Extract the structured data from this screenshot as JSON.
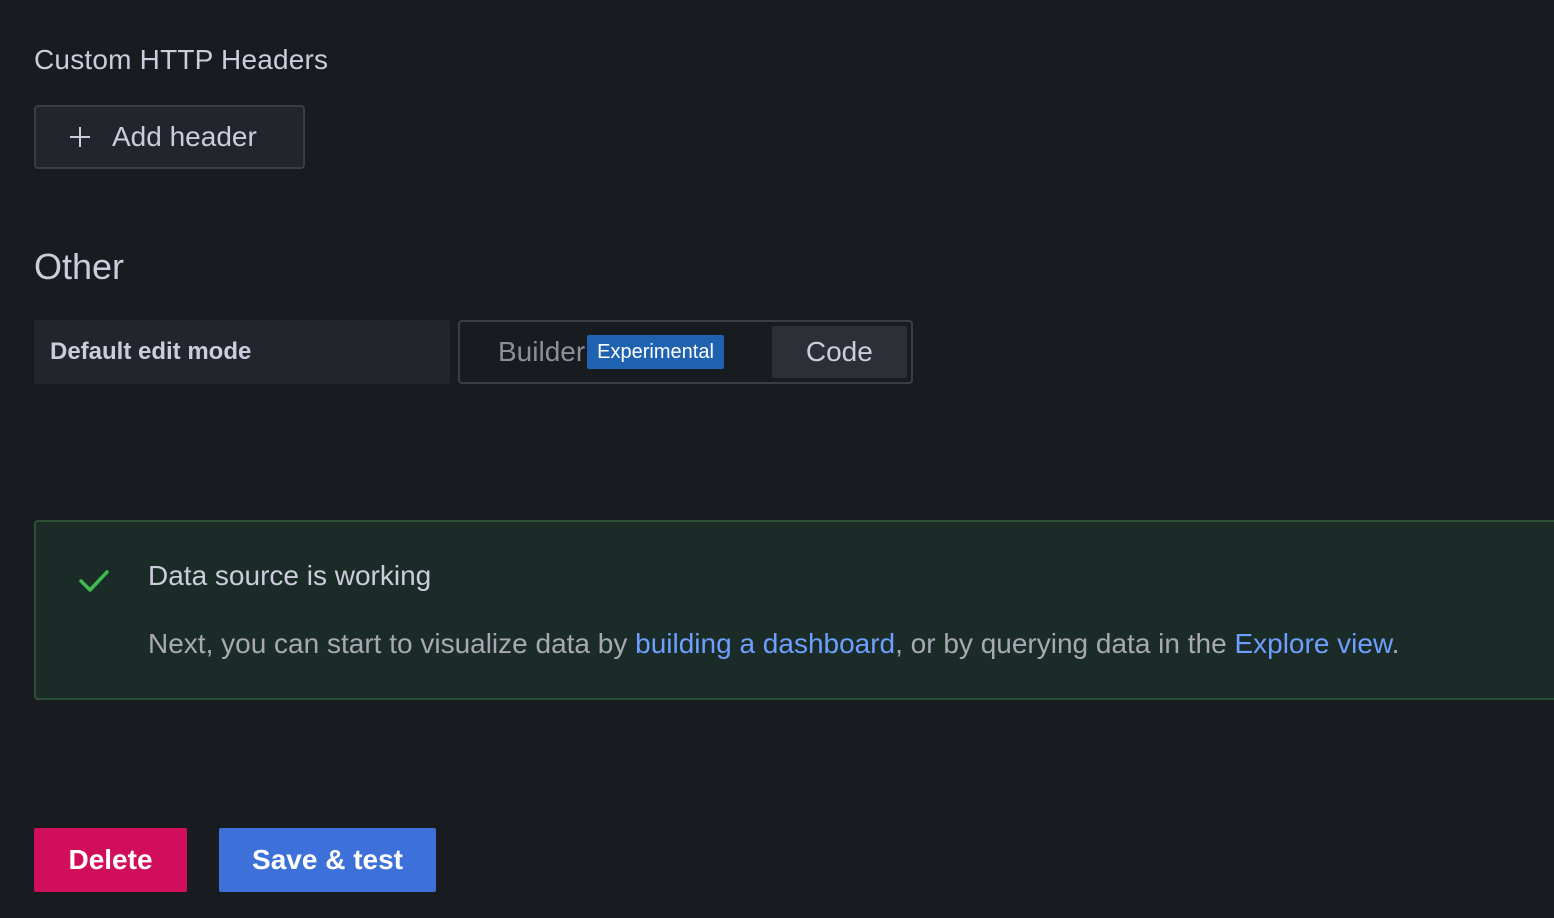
{
  "headers_section": {
    "title": "Custom HTTP Headers",
    "add_button_label": "Add header"
  },
  "other_section": {
    "title": "Other",
    "default_edit_mode": {
      "label": "Default edit mode",
      "options": [
        {
          "label": "Builder",
          "badge": "Experimental",
          "selected": false
        },
        {
          "label": "Code",
          "selected": true
        }
      ]
    }
  },
  "alert": {
    "status": "success",
    "title": "Data source is working",
    "body_prefix": "Next, you can start to visualize data by ",
    "link1": "building a dashboard",
    "body_middle": ", or by querying data in the ",
    "link2": "Explore view",
    "body_suffix": "."
  },
  "actions": {
    "delete_label": "Delete",
    "save_label": "Save & test"
  },
  "icons": {
    "add": "plus-icon",
    "success": "check-icon"
  },
  "colors": {
    "background": "#181b1f",
    "delete": "#d10e5c",
    "primary": "#3d71d9",
    "success_border": "#2b5236",
    "success_icon": "#3fb950",
    "link": "#6e9fff",
    "badge": "#1f62b0"
  }
}
